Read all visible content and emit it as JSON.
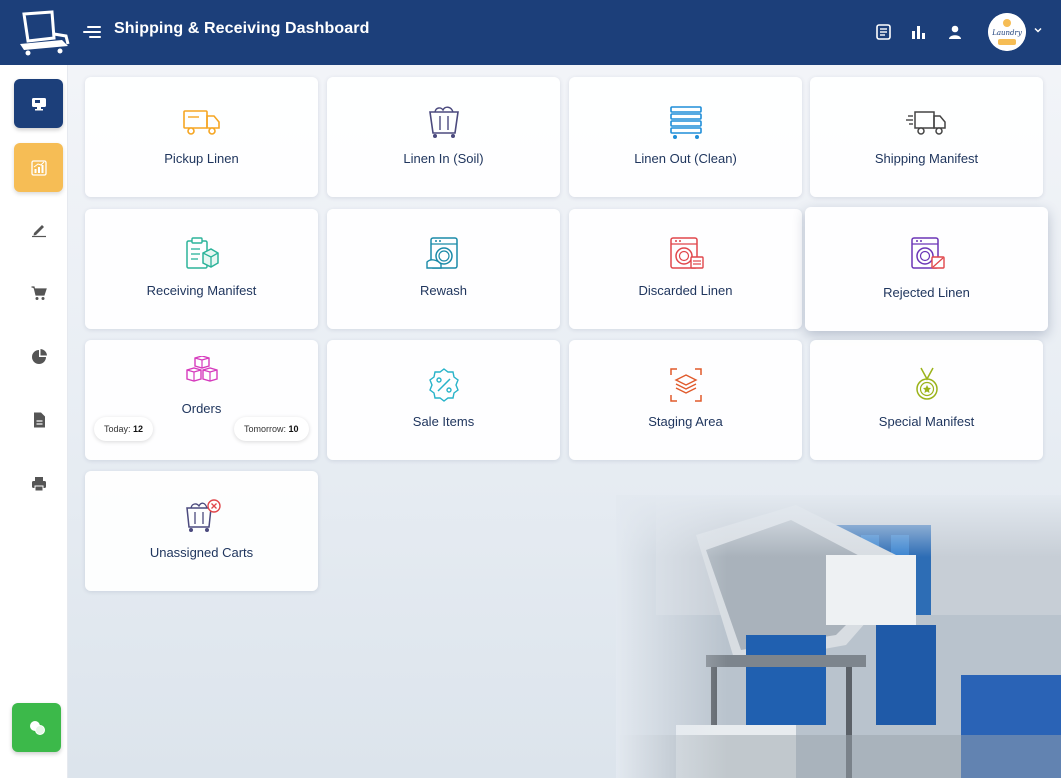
{
  "header": {
    "title": "Shipping & Receiving Dashboard",
    "logo_icon": "laundry-cart-logo",
    "icons": [
      "news-icon",
      "bar-chart-icon",
      "user-icon"
    ],
    "avatar_text": "Laundry"
  },
  "sidebar": {
    "items": [
      {
        "icon": "monitor-icon",
        "state": "active-blue"
      },
      {
        "icon": "analytics-icon",
        "state": "active-orange"
      },
      {
        "icon": "edit-icon",
        "state": "normal"
      },
      {
        "icon": "cart-icon",
        "state": "normal"
      },
      {
        "icon": "pie-chart-icon",
        "state": "normal"
      },
      {
        "icon": "document-icon",
        "state": "normal"
      },
      {
        "icon": "printer-icon",
        "state": "normal"
      },
      {
        "icon": "chat-icon",
        "state": "green"
      }
    ]
  },
  "tiles": [
    {
      "label": "Pickup Linen",
      "icon": "truck-icon",
      "color": "#f5a623"
    },
    {
      "label": "Linen In (Soil)",
      "icon": "soil-cart-icon",
      "color": "#4b4a7e"
    },
    {
      "label": "Linen Out (Clean)",
      "icon": "clean-cart-icon",
      "color": "#1f8ed8"
    },
    {
      "label": "Shipping Manifest",
      "icon": "delivery-truck-icon",
      "color": "#444444"
    },
    {
      "label": "Receiving Manifest",
      "icon": "clipboard-box-icon",
      "color": "#2bb39a"
    },
    {
      "label": "Rewash",
      "icon": "washer-rewash-icon",
      "color": "#1a8aa8"
    },
    {
      "label": "Discarded Linen",
      "icon": "washer-discard-icon",
      "color": "#e0464b"
    },
    {
      "label": "Rejected Linen",
      "icon": "washer-reject-icon",
      "color": "#6b35b6"
    },
    {
      "label": "Orders",
      "icon": "boxes-icon",
      "color": "#d63bbd"
    },
    {
      "label": "Sale Items",
      "icon": "percent-badge-icon",
      "color": "#27b3c9"
    },
    {
      "label": "Staging Area",
      "icon": "layers-focus-icon",
      "color": "#e05a2b"
    },
    {
      "label": "Special Manifest",
      "icon": "medal-icon",
      "color": "#9bb31a"
    },
    {
      "label": "Unassigned Carts",
      "icon": "cart-remove-icon",
      "color": "#4b4a7e"
    }
  ],
  "orders": {
    "today_label": "Today:",
    "today_value": "12",
    "tomorrow_label": "Tomorrow:",
    "tomorrow_value": "10"
  }
}
